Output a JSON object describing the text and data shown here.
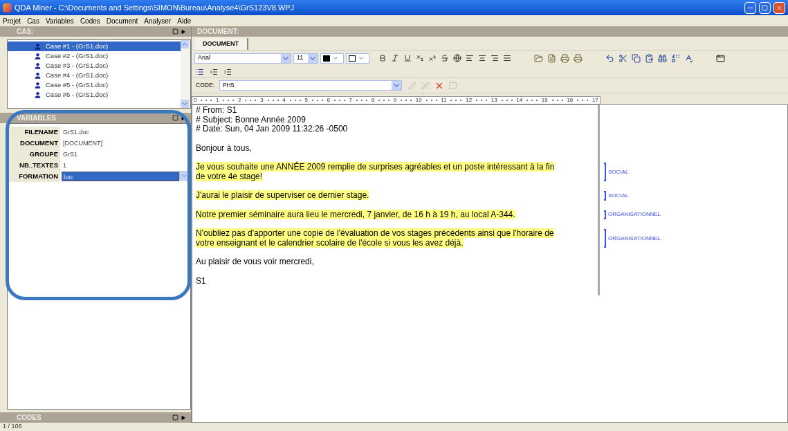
{
  "window": {
    "title": "QDA Miner - C:\\Documents and Settings\\SIMON\\Bureau\\Analyse4\\GrS123V8.WPJ"
  },
  "menu": [
    "Projet",
    "Cas",
    "Variables",
    "Codes",
    "Document",
    "Analyser",
    "Aide"
  ],
  "cases": {
    "title": "CAS:",
    "items": [
      {
        "label": "Case #1 - (GrS1.doc)",
        "selected": true
      },
      {
        "label": "Case #2 - (GrS1.doc)",
        "selected": false
      },
      {
        "label": "Case #3 - (GrS1.doc)",
        "selected": false
      },
      {
        "label": "Case #4 - (GrS1.doc)",
        "selected": false
      },
      {
        "label": "Case #5 - (GrS1.doc)",
        "selected": false
      },
      {
        "label": "Case #6 - (GrS1.doc)",
        "selected": false
      }
    ]
  },
  "variables": {
    "title": "VARIABLES",
    "rows": [
      {
        "name": "FILENAME",
        "value": "GrS1.doc",
        "selected": false
      },
      {
        "name": "DOCUMENT",
        "value": "[DOCUMENT]",
        "selected": false
      },
      {
        "name": "GROUPE",
        "value": "GrS1",
        "selected": false
      },
      {
        "name": "NB_TEXTES",
        "value": "1",
        "selected": false
      },
      {
        "name": "FORMATION",
        "value": "bac",
        "selected": true
      }
    ]
  },
  "codes_panel": {
    "title": "CODES"
  },
  "status_bar": "1 / 106",
  "document": {
    "header": "DOCUMENT:",
    "tabs": [
      {
        "label": "DOCUMENT",
        "selected": true
      }
    ],
    "font": "Arial",
    "size": "11",
    "code_label": "CODE:",
    "code_value": "PH5",
    "ruler": [
      "0",
      "1",
      "2",
      "3",
      "4",
      "5",
      "6",
      "7",
      "8",
      "9",
      "10",
      "11",
      "12",
      "13",
      "14",
      "15",
      "16",
      "17"
    ],
    "paragraphs": [
      {
        "lines": [
          "# From: S1",
          "# Subject: Bonne Année 2009",
          "# Date: Sun, 04 Jan 2009 11:32:26 -0500"
        ],
        "highlighted": false
      },
      {
        "lines": [
          "Bonjour à tous,"
        ],
        "highlighted": false
      },
      {
        "lines": [
          "Je vous souhaite une ANNÉE 2009 remplie de surprises agréables et un poste intéressant à la fin",
          "de votre 4e stage!"
        ],
        "highlighted": true,
        "code": "SOCIAL"
      },
      {
        "lines": [
          "J'aurai le plaisir de superviser ce dernier stage."
        ],
        "highlighted": true,
        "code": "SOCIAL"
      },
      {
        "lines": [
          "Notre premier séminaire aura lieu le mercredi, 7 janvier, de 16 h à 19 h, au local A-344."
        ],
        "highlighted": true,
        "code": "ORGANISATIONNEL"
      },
      {
        "lines": [
          "N'oubliez pas d'apporter une copie de l'évaluation de vos stages précédents ainsi que l'horaire de",
          "votre enseignant et le calendrier scolaire de l'école si vous les avez déjà."
        ],
        "highlighted": true,
        "code": "ORGANISATIONNEL"
      },
      {
        "lines": [
          "Au plaisir de vous voir mercredi,"
        ],
        "highlighted": false
      },
      {
        "lines": [
          "S1"
        ],
        "highlighted": false
      }
    ]
  }
}
